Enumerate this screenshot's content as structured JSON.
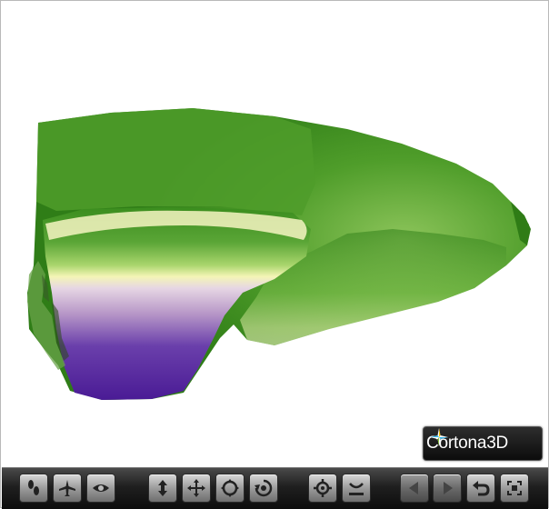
{
  "viewer": {
    "logo_text": "Cortona3D",
    "colors": {
      "terrain_low": "#4b1c96",
      "terrain_mid": "#e8d8ee",
      "terrain_band": "#f5f5b4",
      "terrain_high": "#3a8a1e",
      "toolbar": "#1c1c1c"
    }
  },
  "toolbar": {
    "buttons": [
      {
        "name": "walk-mode-button",
        "icon": "footsteps-icon"
      },
      {
        "name": "fly-mode-button",
        "icon": "plane-icon"
      },
      {
        "name": "study-mode-button",
        "icon": "eye-icon"
      },
      {
        "name": "plan-button",
        "icon": "up-down-arrow-icon"
      },
      {
        "name": "pan-button",
        "icon": "four-way-arrow-icon"
      },
      {
        "name": "turn-button",
        "icon": "turn-icon"
      },
      {
        "name": "roll-button",
        "icon": "roll-icon"
      },
      {
        "name": "goto-button",
        "icon": "crosshair-icon"
      },
      {
        "name": "align-button",
        "icon": "align-icon"
      },
      {
        "name": "previous-viewpoint-button",
        "icon": "triangle-left-icon"
      },
      {
        "name": "next-viewpoint-button",
        "icon": "triangle-right-icon"
      },
      {
        "name": "restore-button",
        "icon": "undo-arrow-icon"
      },
      {
        "name": "fit-button",
        "icon": "fit-frame-icon"
      }
    ]
  }
}
